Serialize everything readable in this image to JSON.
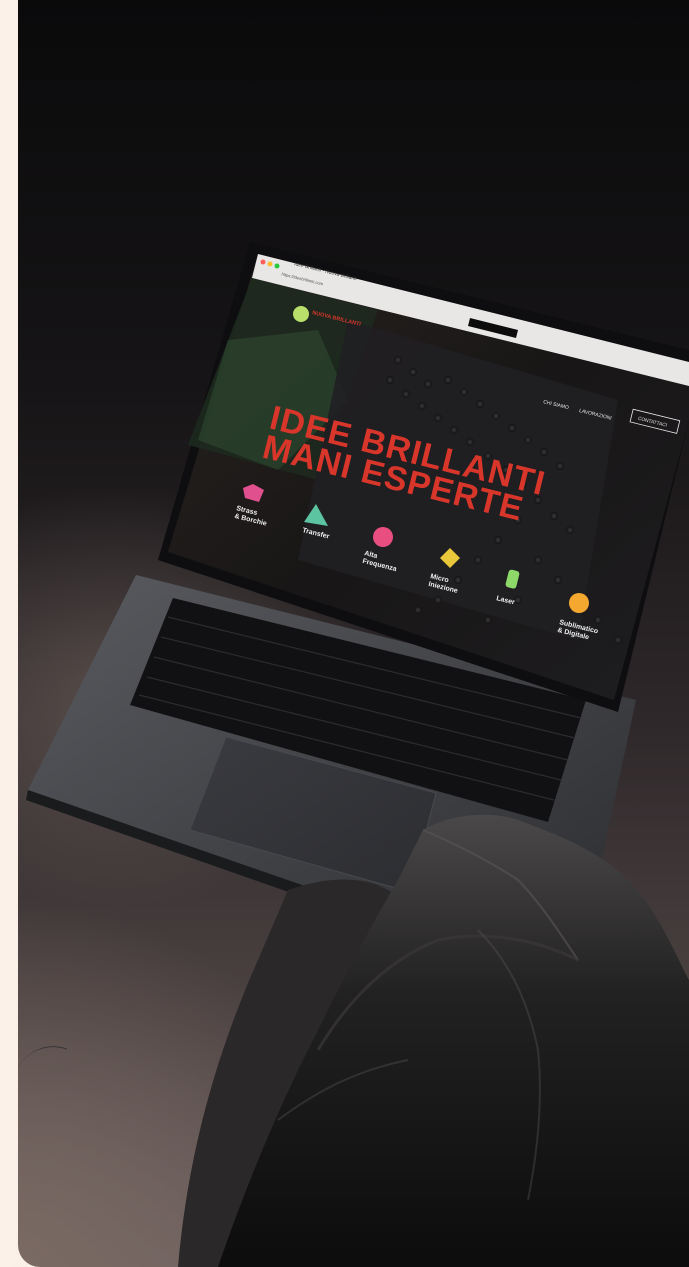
{
  "browser": {
    "tab_title": "Idee Brillanti - Nuova Brillanti",
    "url": "https://ideebrillanti.com"
  },
  "site": {
    "logo_text": "NUOVA BRILLANTI",
    "nav": [
      "CHI SIAMO",
      "LAVORAZIONI"
    ],
    "contact_button": "CONTATTACI",
    "headline_line1": "IDEE BRILLANTI",
    "headline_line2": "MANI ESPERTE",
    "services": [
      {
        "title_line1": "Strass",
        "title_line2": "& Borchie",
        "color": "#e0508f"
      },
      {
        "title_line1": "Transfer",
        "title_line2": "",
        "color": "#5cc4a0"
      },
      {
        "title_line1": "Alta",
        "title_line2": "Frequenza",
        "color": "#e84e80"
      },
      {
        "title_line1": "Micro",
        "title_line2": "Iniezione",
        "color": "#e8c83a"
      },
      {
        "title_line1": "Laser",
        "title_line2": "",
        "color": "#8ed86a"
      },
      {
        "title_line1": "Sublimatico",
        "title_line2": "& Digitale",
        "color": "#f5a830"
      }
    ]
  },
  "colors": {
    "accent_red": "#d9362b",
    "page_bg": "#f6e3d3",
    "panel_dark": "#111012"
  }
}
